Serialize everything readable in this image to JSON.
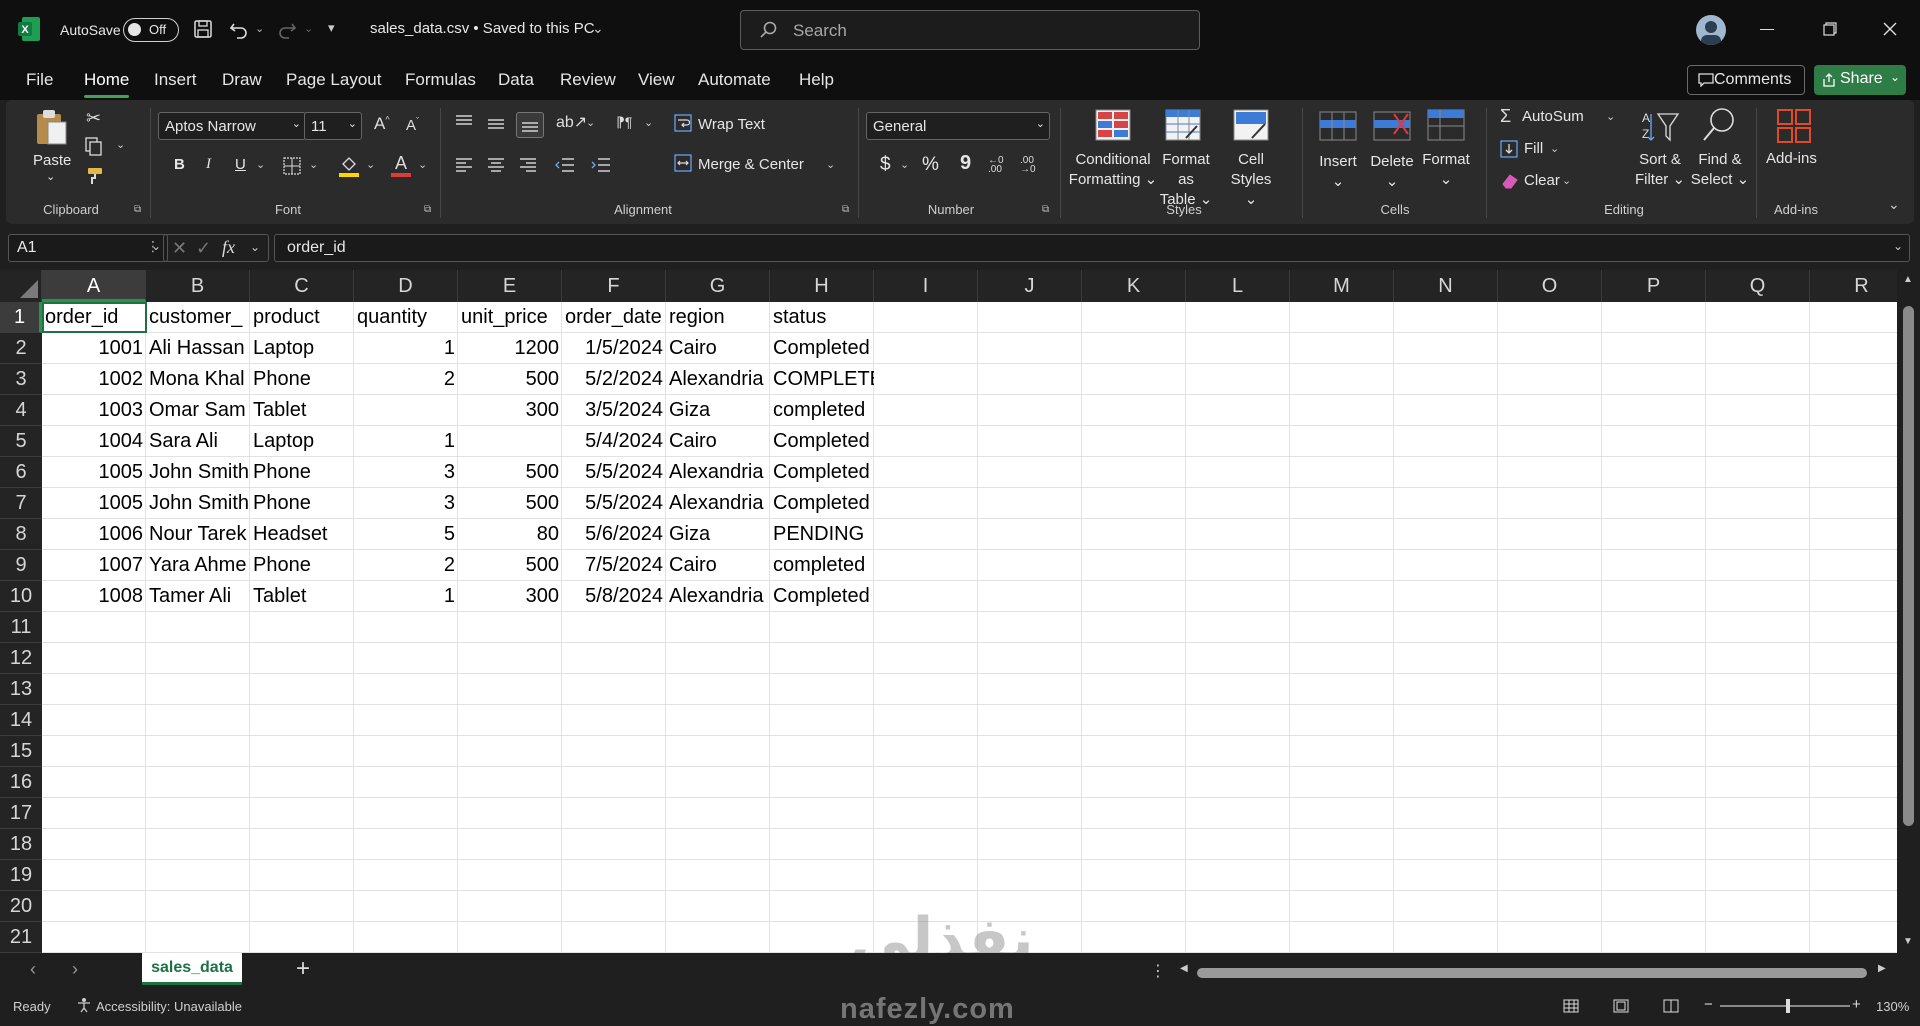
{
  "titlebar": {
    "autosave_label": "AutoSave",
    "autosave_state": "Off",
    "filename": "sales_data.csv • Saved to this PC",
    "search_placeholder": "Search"
  },
  "menu": {
    "items": [
      "File",
      "Home",
      "Insert",
      "Draw",
      "Page Layout",
      "Formulas",
      "Data",
      "Review",
      "View",
      "Automate",
      "Help"
    ],
    "active": "Home",
    "comments_label": "Comments",
    "share_label": "Share"
  },
  "ribbon": {
    "clipboard": {
      "label": "Clipboard",
      "paste": "Paste"
    },
    "font": {
      "label": "Font",
      "font_name": "Aptos Narrow",
      "font_size": "11",
      "bold": "B",
      "italic": "I",
      "underline": "U"
    },
    "alignment": {
      "label": "Alignment",
      "wrap_text": "Wrap Text",
      "merge_center": "Merge & Center"
    },
    "number": {
      "label": "Number",
      "format": "General",
      "currency": "$",
      "percent": "%",
      "comma": "9"
    },
    "styles": {
      "label": "Styles",
      "conditional": "Conditional\nFormatting",
      "format_table": "Format as\nTable",
      "cell_styles": "Cell\nStyles"
    },
    "cells": {
      "label": "Cells",
      "insert": "Insert",
      "delete": "Delete",
      "format": "Format"
    },
    "editing": {
      "label": "Editing",
      "autosum": "AutoSum",
      "fill": "Fill",
      "clear": "Clear",
      "sort_filter": "Sort &\nFilter",
      "find_select": "Find &\nSelect"
    },
    "addins": {
      "label": "Add-ins",
      "addins": "Add-ins"
    }
  },
  "formula_bar": {
    "name_box": "A1",
    "fx": "fx",
    "content": "order_id"
  },
  "grid": {
    "columns": [
      "A",
      "B",
      "C",
      "D",
      "E",
      "F",
      "G",
      "H",
      "I",
      "J",
      "K",
      "L",
      "M",
      "N",
      "O",
      "P",
      "Q",
      "R"
    ],
    "row_numbers": [
      "1",
      "2",
      "3",
      "4",
      "5",
      "6",
      "7",
      "8",
      "9",
      "10",
      "11",
      "12",
      "13",
      "14",
      "15",
      "16",
      "17",
      "18",
      "19",
      "20",
      "21"
    ],
    "headers": [
      "order_id",
      "customer_",
      "product",
      "quantity",
      "unit_price",
      "order_date",
      "region",
      "status"
    ],
    "rows": [
      [
        "1001",
        "Ali Hassan",
        "Laptop",
        "1",
        "1200",
        "1/5/2024",
        " Cairo",
        "Completed"
      ],
      [
        "1002",
        "Mona Khal",
        "Phone",
        "2",
        "500",
        "5/2/2024",
        "Alexandria",
        "COMPLETED"
      ],
      [
        "1003",
        "Omar Sam",
        "Tablet",
        "",
        "300",
        "3/5/2024",
        " Giza",
        "completed"
      ],
      [
        "1004",
        "Sara Ali",
        "Laptop",
        "1",
        "",
        "5/4/2024",
        "Cairo",
        "Completed"
      ],
      [
        "1005",
        "John Smith",
        "Phone",
        "3",
        "500",
        "5/5/2024",
        " Alexandria",
        "Completed"
      ],
      [
        "1005",
        "John Smith",
        "Phone",
        "3",
        "500",
        "5/5/2024",
        " Alexandria",
        "Completed"
      ],
      [
        "1006",
        "Nour Tarek",
        "Headset",
        "5",
        "80",
        "5/6/2024",
        "Giza",
        "PENDING"
      ],
      [
        "1007",
        "Yara Ahme",
        "Phone",
        "2",
        "500",
        "7/5/2024",
        " Cairo",
        "completed"
      ],
      [
        "1008",
        "Tamer Ali",
        "Tablet",
        "1",
        "300",
        "5/8/2024",
        "Alexandria",
        "Completed"
      ]
    ]
  },
  "sheets": {
    "active": "sales_data",
    "add": "+"
  },
  "statusbar": {
    "ready": "Ready",
    "accessibility": "Accessibility: Unavailable",
    "zoom": "130%"
  },
  "watermark": {
    "arabic": "نفذلي",
    "domain": "nafezly.com"
  }
}
